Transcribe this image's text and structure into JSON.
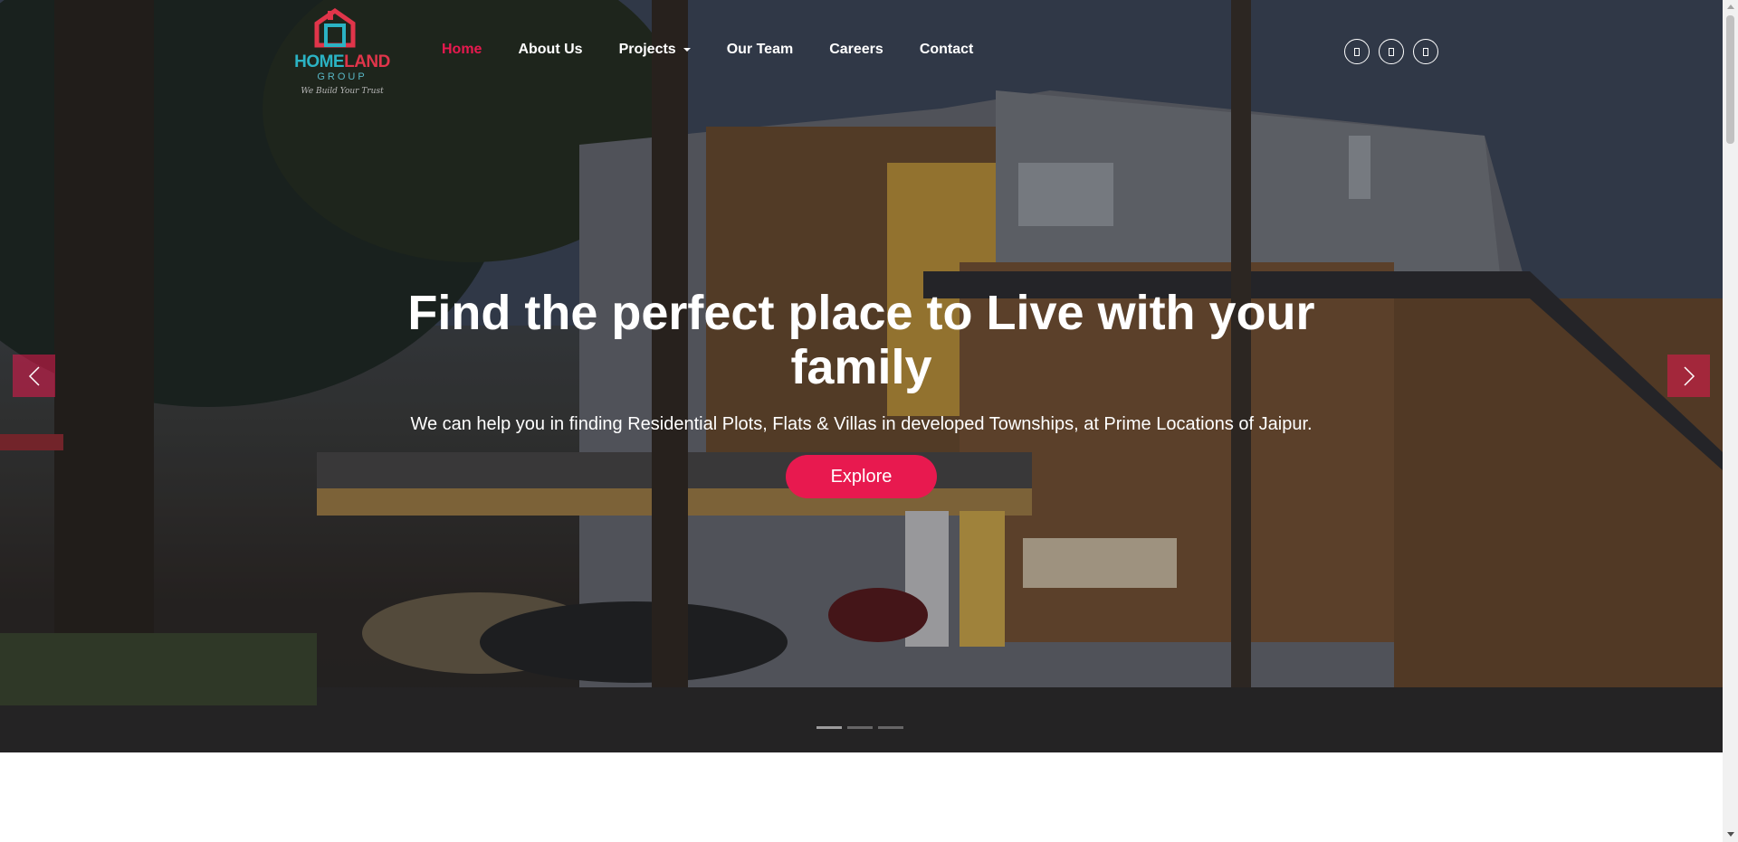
{
  "brand": {
    "name_part1": "HOME",
    "name_part2": "LAND",
    "sub": "GROUP",
    "tagline": "We Build Your Trust"
  },
  "nav": {
    "items": [
      {
        "label": "Home",
        "active": true
      },
      {
        "label": "About Us"
      },
      {
        "label": "Projects",
        "has_dropdown": true
      },
      {
        "label": "Our Team"
      },
      {
        "label": "Careers"
      },
      {
        "label": "Contact"
      }
    ]
  },
  "social": {
    "icons": [
      "social-icon",
      "social-icon",
      "social-icon"
    ]
  },
  "hero": {
    "title": "Find the perfect place to Live with your family",
    "subtitle": "We can help you in finding Residential Plots, Flats & Villas in developed Townships, at Prime Locations of Jaipur.",
    "cta_label": "Explore",
    "prev_icon": "chevron-left-icon",
    "next_icon": "chevron-right-icon",
    "slide_count": 3,
    "active_slide": 1
  },
  "colors": {
    "accent": "#e8194f",
    "logo_teal": "#2bb3c4",
    "logo_red": "#e0354a"
  }
}
